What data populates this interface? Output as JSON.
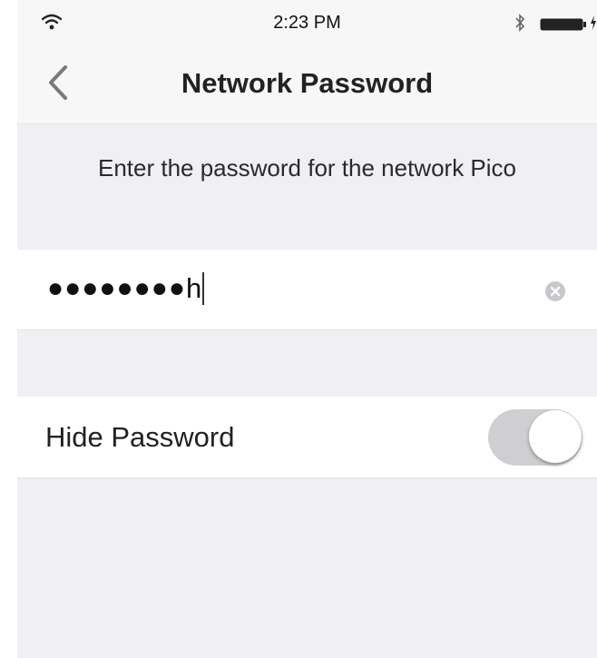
{
  "status_bar": {
    "time": "2:23 PM"
  },
  "nav": {
    "title": "Network Password"
  },
  "prompt": "Enter the password for the network Pico",
  "password": {
    "masked": "●●●●●●●●",
    "last_char": "h"
  },
  "hide_password": {
    "label": "Hide Password",
    "enabled": true
  },
  "colors": {
    "background": "#efeff4",
    "bar": "#f7f7f7",
    "toggle_track": "#cfcfd2"
  }
}
